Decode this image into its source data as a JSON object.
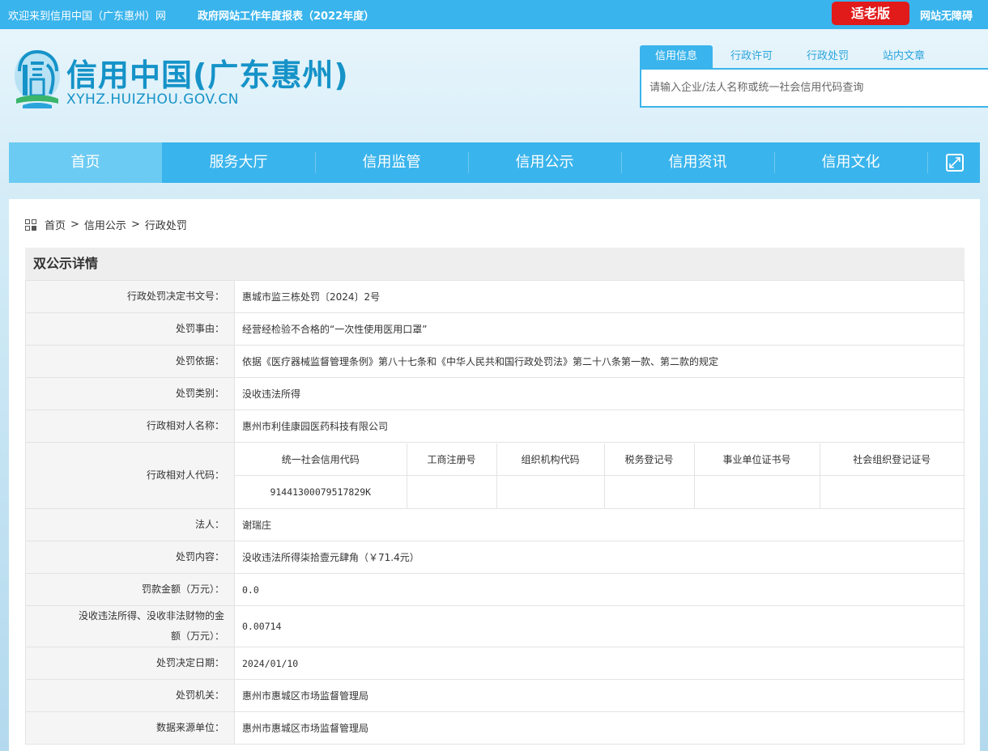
{
  "topbar": {
    "welcome": "欢迎来到信用中国（广东惠州）网",
    "report": "政府网站工作年度报表（2022年度）",
    "elder_mode": "适老版",
    "accessibility": "网站无障碍"
  },
  "header": {
    "title": "信用中国(广东惠州)",
    "domain": "XYHZ.HUIZHOU.GOV.CN"
  },
  "search": {
    "tabs": [
      "信用信息",
      "行政许可",
      "行政处罚",
      "站内文章"
    ],
    "placeholder": "请输入企业/法人名称或统一社会信用代码查询"
  },
  "nav": {
    "items": [
      "首页",
      "服务大厅",
      "信用监管",
      "信用公示",
      "信用资讯",
      "信用文化"
    ]
  },
  "breadcrumb": [
    "首页",
    "信用公示",
    "行政处罚"
  ],
  "detail": {
    "heading": "双公示详情",
    "rows": [
      {
        "label": "行政处罚决定书文号：",
        "value": "惠城市监三栋处罚〔2024〕2号"
      },
      {
        "label": "处罚事由：",
        "value": "经营经检验不合格的“一次性使用医用口罩”"
      },
      {
        "label": "处罚依据：",
        "value": "依据《医疗器械监督管理条例》第八十七条和《中华人民共和国行政处罚法》第二十八条第一款、第二款的规定"
      },
      {
        "label": "处罚类别：",
        "value": "没收违法所得"
      },
      {
        "label": "行政相对人名称：",
        "value": "惠州市利佳康园医药科技有限公司"
      }
    ],
    "code_row": {
      "label": "行政相对人代码：",
      "headers": [
        "统一社会信用代码",
        "工商注册号",
        "组织机构代码",
        "税务登记号",
        "事业单位证书号",
        "社会组织登记证号"
      ],
      "values": [
        "91441300079517829K",
        "",
        "",
        "",
        "",
        ""
      ]
    },
    "rows2": [
      {
        "label": "法人：",
        "value": "谢瑞庄"
      },
      {
        "label": "处罚内容：",
        "value": "没收违法所得柒拾壹元肆角（￥71.4元）"
      },
      {
        "label": "罚款金额（万元）：",
        "value": "0.0"
      },
      {
        "label": "没收违法所得、没收非法财物的金额（万元）：",
        "value": "0.00714"
      },
      {
        "label": "处罚决定日期：",
        "value": "2024/01/10"
      },
      {
        "label": "处罚机关：",
        "value": "惠州市惠城区市场监督管理局"
      },
      {
        "label": "数据来源单位：",
        "value": "惠州市惠城区市场监督管理局"
      }
    ]
  },
  "colors": {
    "brand_blue": "#3ab4ec",
    "title_blue": "#1593c8",
    "elder_red": "#e11a1a"
  }
}
